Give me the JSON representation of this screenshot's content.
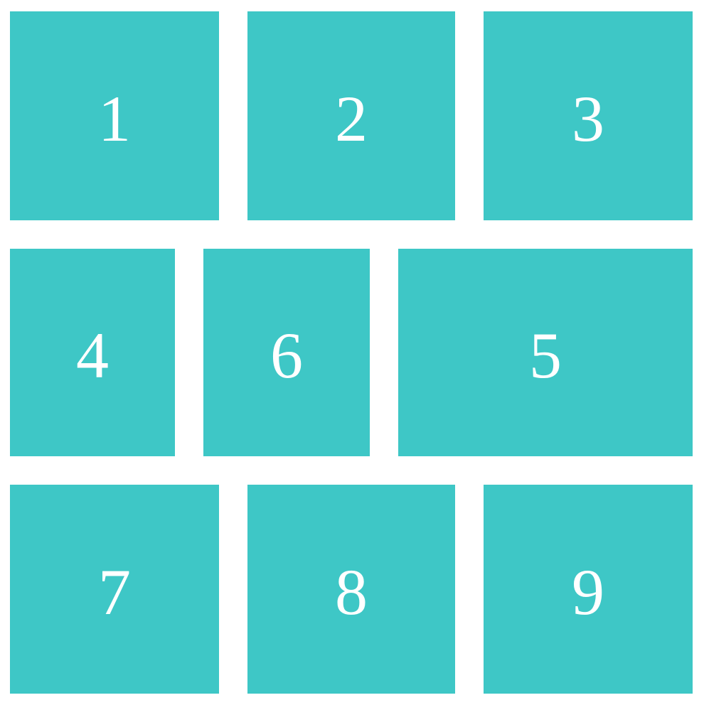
{
  "theme": {
    "tile_color": "#3ec7c6",
    "text_color": "#ffffff",
    "background": "#ffffff"
  },
  "tiles": [
    {
      "label": "1"
    },
    {
      "label": "2"
    },
    {
      "label": "3"
    },
    {
      "label": "4"
    },
    {
      "label": "6"
    },
    {
      "label": "5"
    },
    {
      "label": "7"
    },
    {
      "label": "8"
    },
    {
      "label": "9"
    }
  ]
}
